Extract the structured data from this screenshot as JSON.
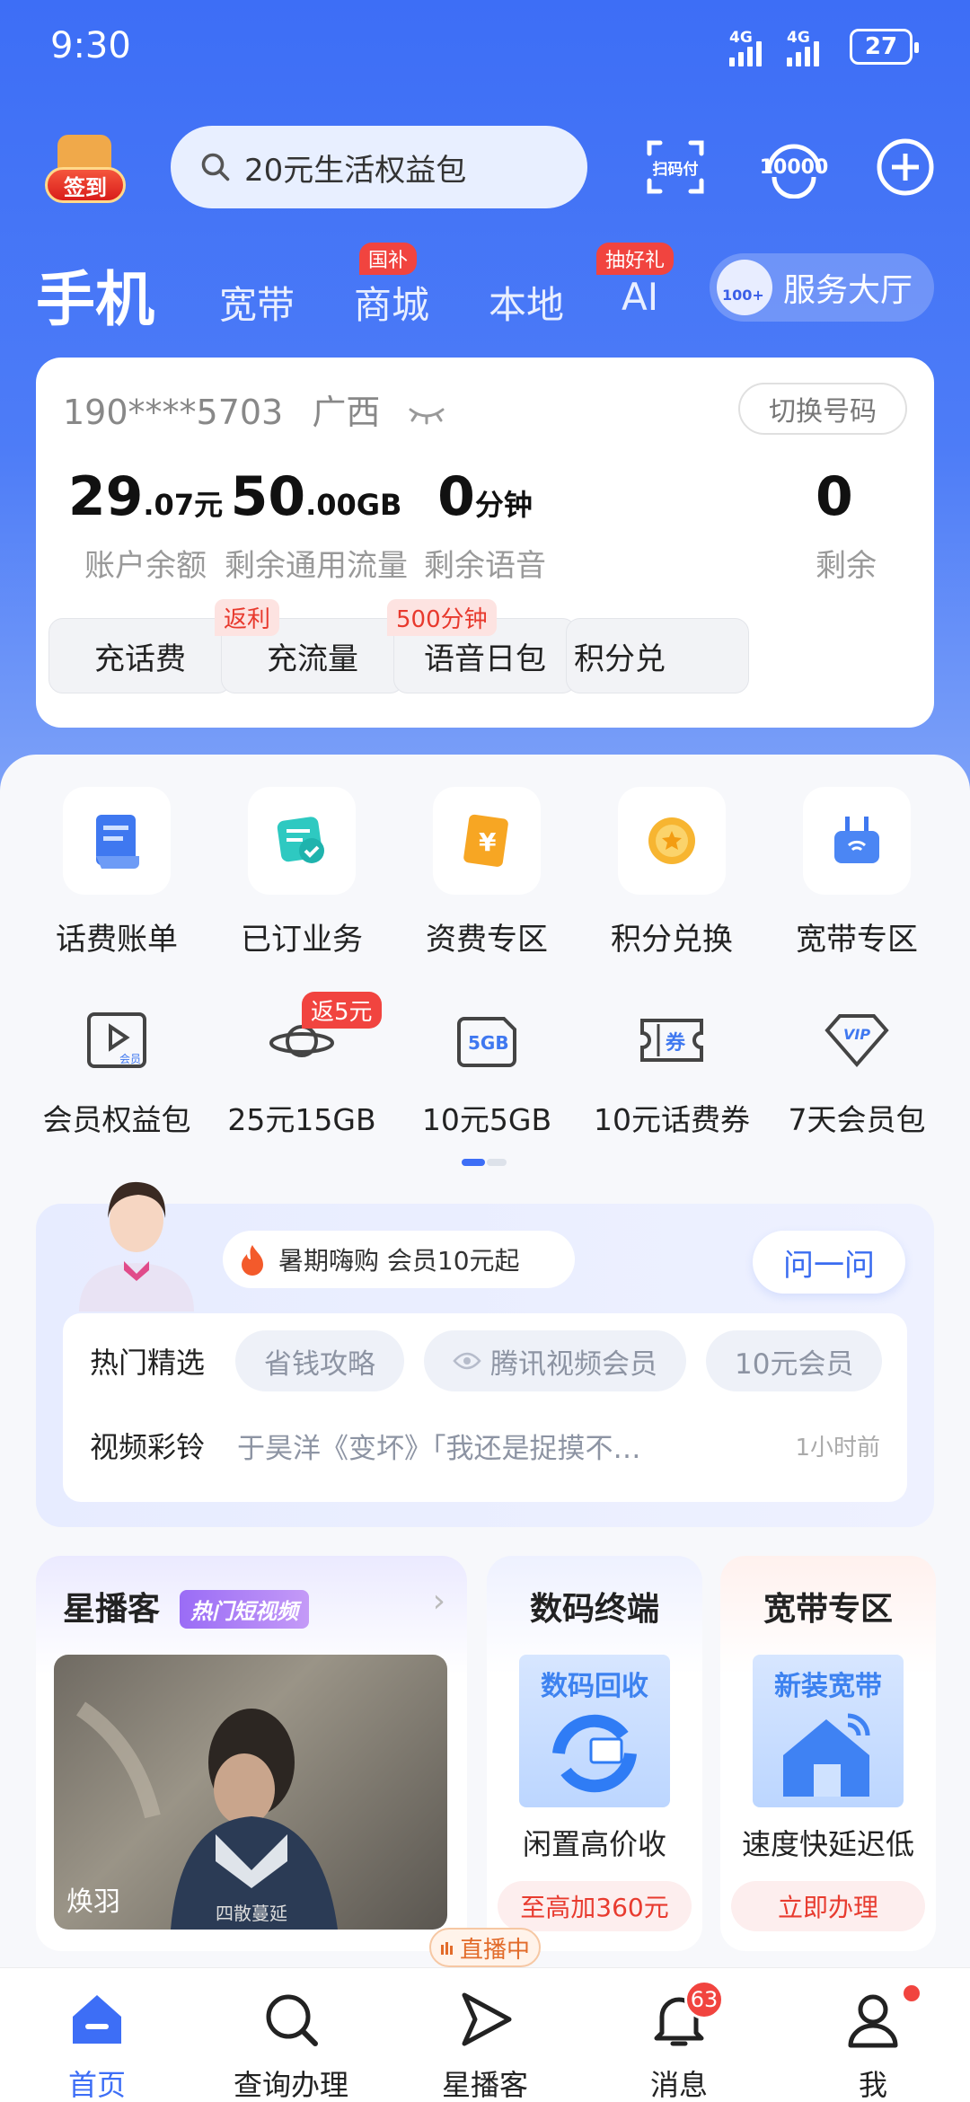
{
  "status_bar": {
    "time": "9:30",
    "network1": "4G",
    "network2": "4G",
    "battery": "27"
  },
  "header": {
    "signin_label": "签到",
    "search_placeholder": "20元生活权益包",
    "scan_label": "扫码付",
    "hotline_label": "10000"
  },
  "nav": {
    "main": "手机",
    "items": [
      {
        "label": "宽带",
        "tag": ""
      },
      {
        "label": "商城",
        "tag": "国补"
      },
      {
        "label": "本地",
        "tag": ""
      },
      {
        "label": "AI",
        "tag": "抽好礼"
      }
    ],
    "service_hall": "服务大厅",
    "service_badge": "100+"
  },
  "account": {
    "phone": "190****5703",
    "region": "广西",
    "switch_label": "切换号码",
    "stats": [
      {
        "value": "29",
        "decimal": ".07",
        "unit": "元",
        "label": "账户余额",
        "button": "充话费",
        "tag": ""
      },
      {
        "value": "50",
        "decimal": ".00",
        "unit": "GB",
        "label": "剩余通用流量",
        "button": "充流量",
        "tag": "返利"
      },
      {
        "value": "0",
        "decimal": "",
        "unit": "分钟",
        "label": "剩余语音",
        "button": "语音日包",
        "tag": "500分钟"
      },
      {
        "value": "0",
        "decimal": "",
        "unit": "",
        "label": "剩余",
        "button": "积分兑",
        "tag": ""
      }
    ]
  },
  "quick_grid": [
    {
      "label": "话费账单",
      "icon": "bill-icon"
    },
    {
      "label": "已订业务",
      "icon": "subscribed-icon"
    },
    {
      "label": "资费专区",
      "icon": "tariff-icon"
    },
    {
      "label": "积分兑换",
      "icon": "points-icon"
    },
    {
      "label": "宽带专区",
      "icon": "router-icon"
    }
  ],
  "quick_grid2": [
    {
      "label": "会员权益包",
      "icon": "member-video-icon",
      "tag": "",
      "icon_text": "会员"
    },
    {
      "label": "25元15GB",
      "icon": "planet-icon",
      "tag": "返5元",
      "icon_text": ""
    },
    {
      "label": "10元5GB",
      "icon": "5gb-icon",
      "tag": "",
      "icon_text": "5GB"
    },
    {
      "label": "10元话费券",
      "icon": "coupon-icon",
      "tag": "",
      "icon_text": "券"
    },
    {
      "label": "7天会员包",
      "icon": "vip-diamond-icon",
      "tag": "",
      "icon_text": "VIP"
    }
  ],
  "promo": {
    "chip": "暑期嗨购  会员10元起",
    "ask": "问一问",
    "row1_title": "热门精选",
    "pills": [
      "省钱攻略",
      "腾讯视频会员",
      "10元会员"
    ],
    "row2_title": "视频彩铃",
    "row2_text": "于昊洋《变坏》「我还是捉摸不…",
    "row2_time": "1小时前"
  },
  "tiles": {
    "xingboke": {
      "title": "星播客",
      "tag": "热门短视频",
      "name": "焕羽",
      "caption": "四散蔓延"
    },
    "digital": {
      "title": "数码终端",
      "pic_title": "数码回收",
      "sub": "闲置高价收",
      "tag": "至高加360元"
    },
    "broadband": {
      "title": "宽带专区",
      "pic_title": "新装宽带",
      "sub": "速度快延迟低",
      "tag": "立即办理"
    }
  },
  "tabbar": {
    "items": [
      {
        "label": "首页",
        "icon": "home-icon",
        "active": true
      },
      {
        "label": "查询办理",
        "icon": "query-icon"
      },
      {
        "label": "星播客",
        "icon": "play-icon"
      },
      {
        "label": "消息",
        "icon": "bell-icon",
        "badge": "63"
      },
      {
        "label": "我",
        "icon": "user-icon"
      }
    ],
    "live_label": "直播中"
  },
  "colors": {
    "primary": "#3d6ef6",
    "accent_red": "#e83b2f",
    "text": "#222222",
    "muted": "#999999"
  }
}
